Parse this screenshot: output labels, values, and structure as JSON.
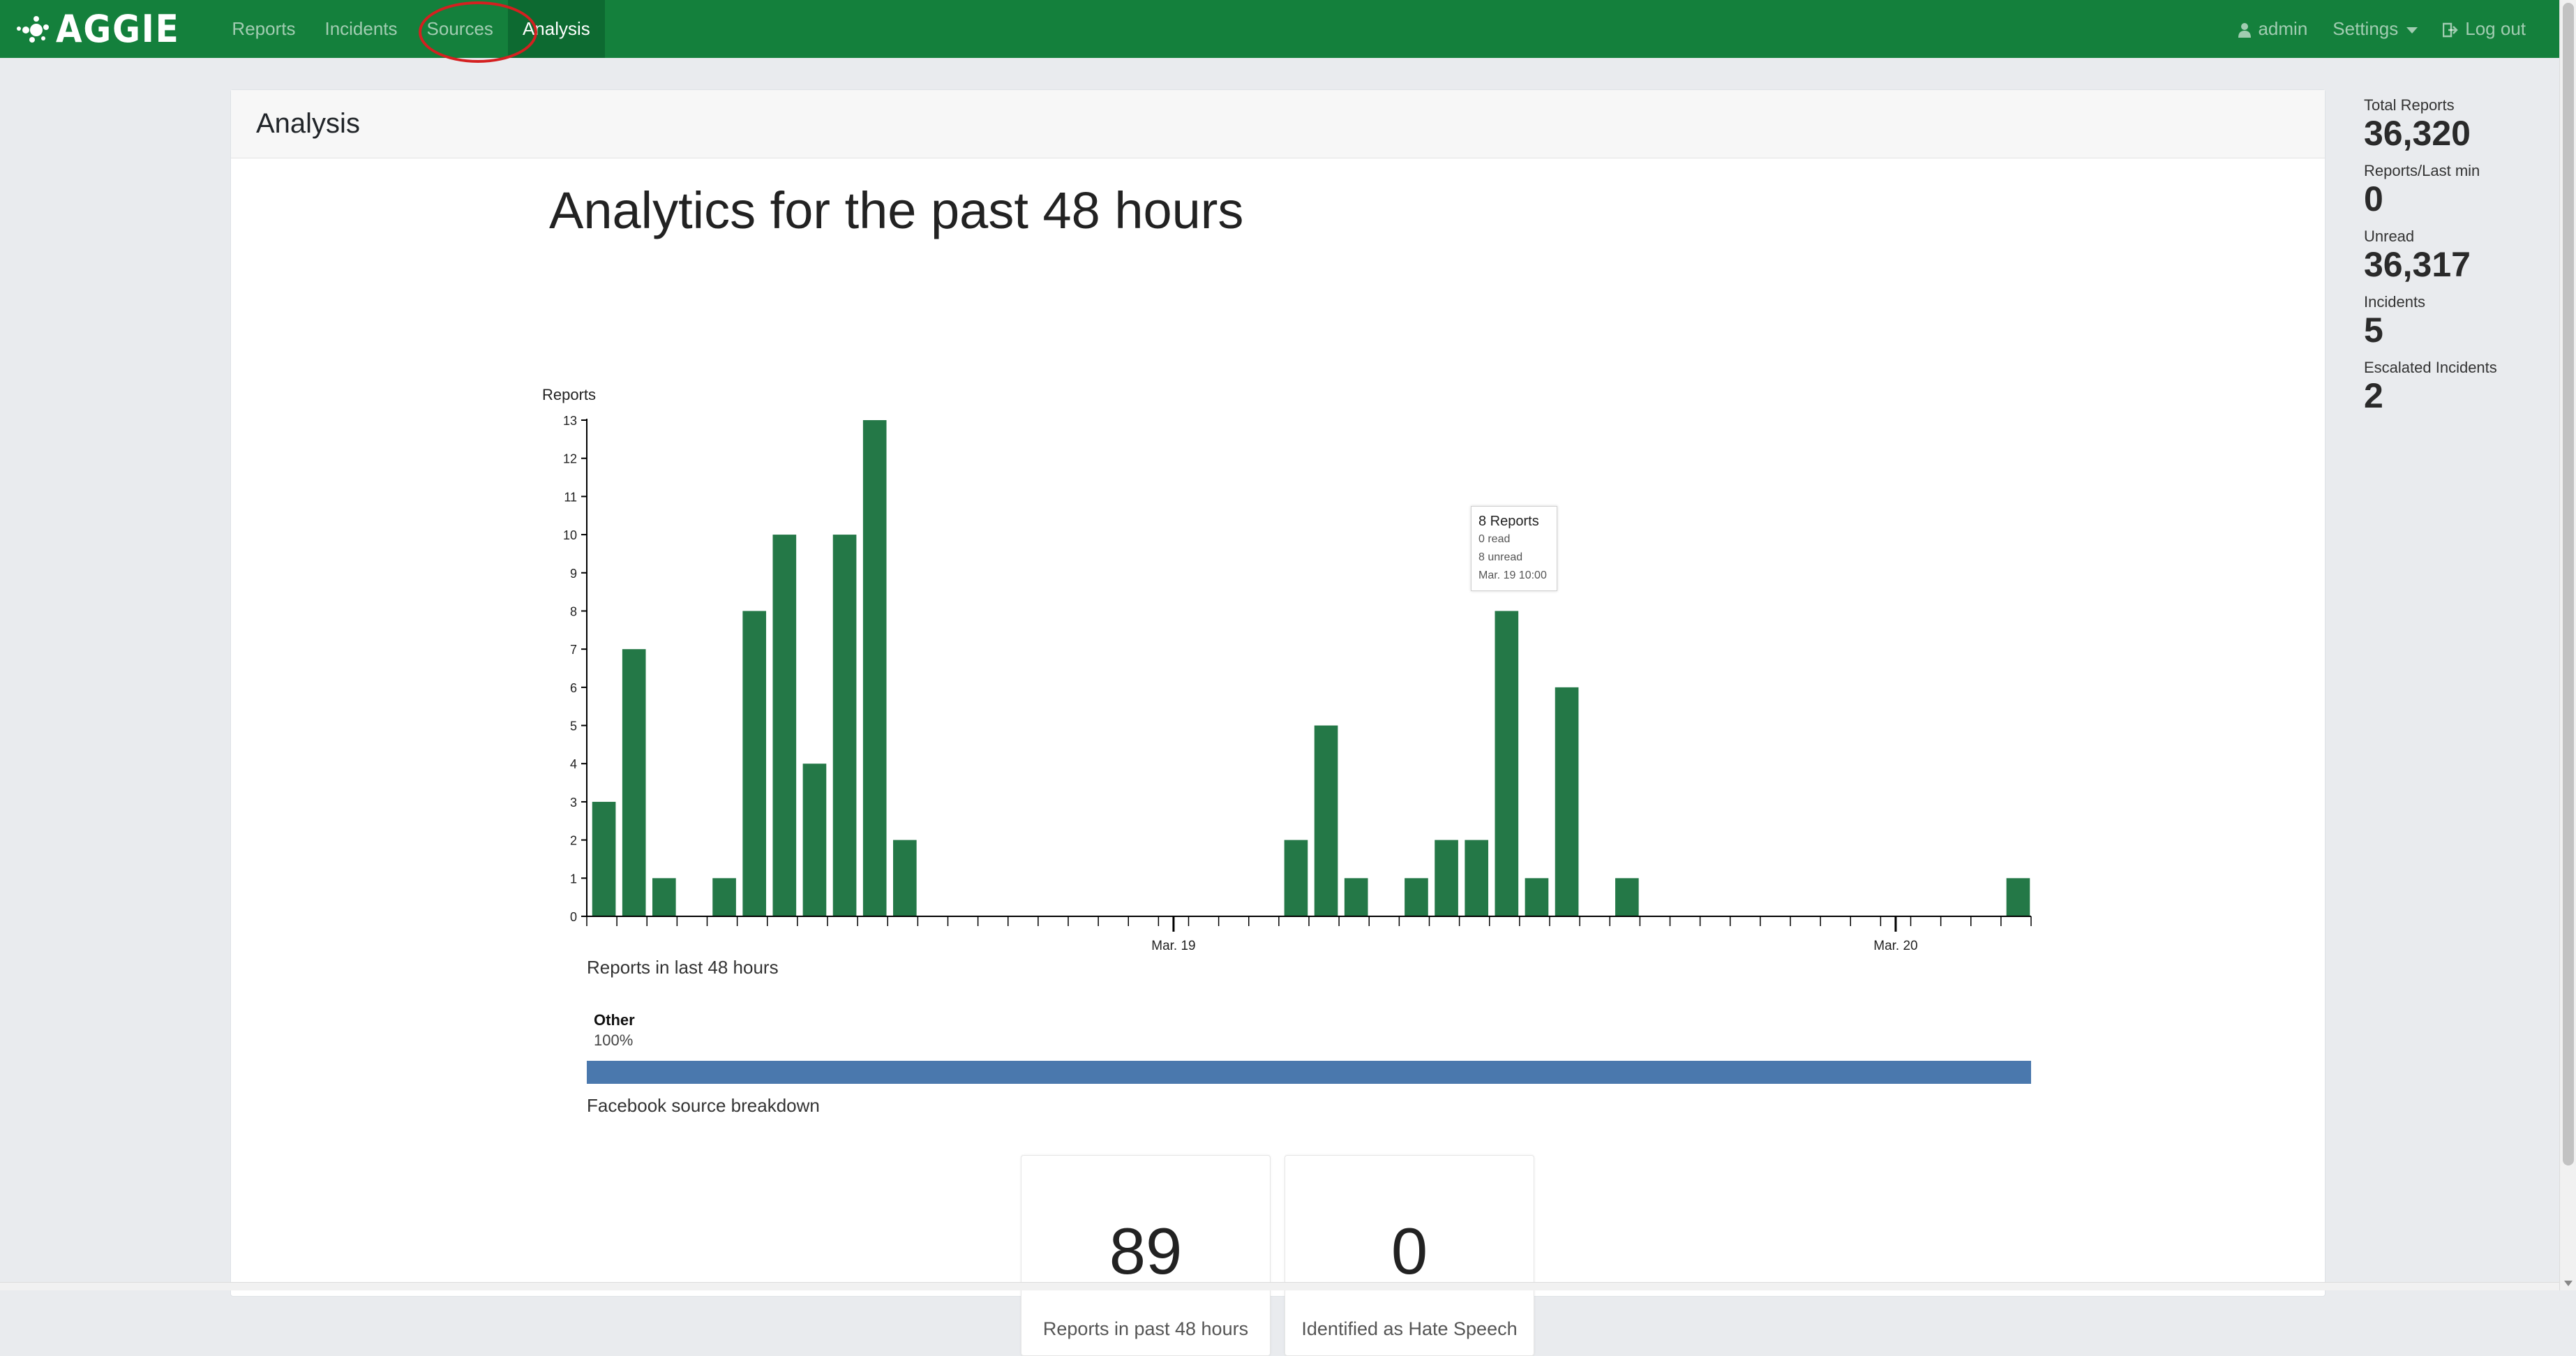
{
  "navbar": {
    "brand": "AGGIE",
    "links": [
      {
        "label": "Reports"
      },
      {
        "label": "Incidents"
      },
      {
        "label": "Sources"
      },
      {
        "label": "Analysis"
      }
    ],
    "user": "admin",
    "settings": "Settings",
    "logout": "Log out"
  },
  "page": {
    "header": "Analysis",
    "title": "Analytics for the past 48 hours"
  },
  "chart_data": {
    "type": "bar",
    "ylabel": "Reports",
    "ylim": [
      0,
      13
    ],
    "yticks": [
      0,
      1,
      2,
      3,
      4,
      5,
      6,
      7,
      8,
      9,
      10,
      11,
      12,
      13
    ],
    "bar_color": "#247847",
    "caption": "Reports in last 48 hours",
    "x_labels": [
      {
        "label": "Mar. 19",
        "hour_index": 20
      },
      {
        "label": "Mar. 20",
        "hour_index": 44
      }
    ],
    "values": [
      3,
      7,
      1,
      0,
      1,
      8,
      10,
      4,
      10,
      13,
      2,
      0,
      0,
      0,
      0,
      0,
      0,
      0,
      0,
      0,
      0,
      0,
      0,
      2,
      5,
      1,
      0,
      1,
      2,
      2,
      8,
      1,
      6,
      0,
      1,
      0,
      0,
      0,
      0,
      0,
      0,
      0,
      0,
      0,
      0,
      0,
      0,
      1
    ],
    "tooltip": {
      "title": "8 Reports",
      "read": "0 read",
      "unread": "8 unread",
      "time": "Mar. 19 10:00"
    }
  },
  "source_breakdown": {
    "name": "Other",
    "percent": "100%",
    "fraction": 1.0,
    "color": "#4a78ad",
    "caption": "Facebook source breakdown"
  },
  "stats": [
    {
      "value": "89",
      "label": "Reports in past 48 hours"
    },
    {
      "value": "0",
      "label": "Identified as Hate Speech"
    }
  ],
  "sidebar": [
    {
      "label": "Total Reports",
      "value": "36,320"
    },
    {
      "label": "Reports/Last min",
      "value": "0"
    },
    {
      "label": "Unread",
      "value": "36,317"
    },
    {
      "label": "Incidents",
      "value": "5"
    },
    {
      "label": "Escalated Incidents",
      "value": "2"
    }
  ],
  "colors": {
    "navbar": "#14803c",
    "highlight": "#d42020"
  }
}
